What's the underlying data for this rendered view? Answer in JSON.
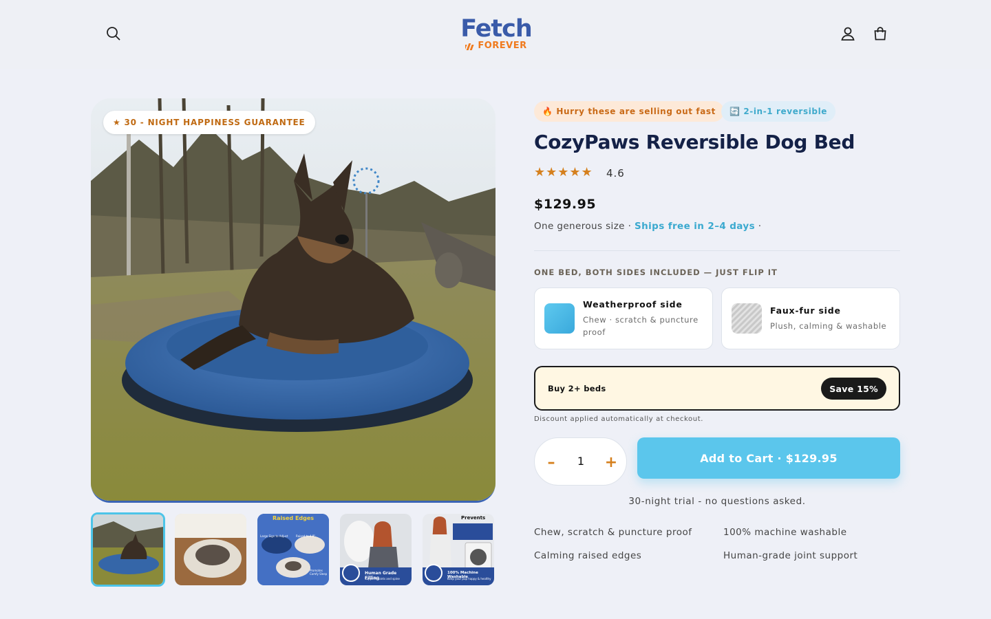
{
  "header": {
    "logo_top": "Fetch",
    "logo_bottom": "FOREVER",
    "search_icon": "search-icon",
    "account_icon": "user-icon",
    "cart_icon": "cart-icon"
  },
  "gallery": {
    "guarantee_badge": "★ 30 - NIGHT HAPPINESS GUARANTEE",
    "main_image": "German shepherd lying in a blue round dog bed outdoors",
    "thumbnails": [
      {
        "label": ""
      },
      {
        "label": ""
      },
      {
        "label": "Raised Edges"
      },
      {
        "label": "Human Grade Filling"
      },
      {
        "label": "100% Machine Washable"
      }
    ],
    "thumb_caption_prevents": "Prevents",
    "thumb_sub_1": "Large Sign to Adjust",
    "thumb_sub_2": "Raised to 4.8\"",
    "thumb_sub_3": "Promotes Comfy Sleep",
    "thumb_sub_4": "Supports joints and spine",
    "thumb_sub_5": "Keep your pup happy & healthy"
  },
  "product": {
    "badge_hurry": "🔥 Hurry these are selling out fast",
    "badge_reversible": "🔄 2-in-1 reversible",
    "title": "CozyPaws Reversible Dog Bed",
    "stars": "★★★★★",
    "rating": "4.6",
    "price": "$129.95",
    "size_text": "One generous size · ",
    "ships_text": "Ships free in 2–4 days",
    "ships_suffix": " ·",
    "sides_label": "ONE BED, BOTH SIDES INCLUDED — JUST FLIP IT",
    "sides": [
      {
        "title": "Weatherproof side",
        "desc_1": "Chew · scratch & puncture",
        "desc_2": "proof"
      },
      {
        "title": "Faux-fur side",
        "desc_1": "Plush, calming & washable"
      }
    ],
    "bundle_label": "Buy 2+ beds",
    "bundle_save": "Save 15%",
    "discount_note": "Discount applied automatically at checkout.",
    "quantity": "1",
    "qty_minus": "–",
    "qty_plus": "+",
    "add_to_cart": "Add to Cart · $129.95",
    "trial": "30-night trial - no questions asked.",
    "features": [
      "Chew, scratch & puncture proof",
      "100% machine washable",
      "Calming raised edges",
      "Human-grade joint support"
    ]
  },
  "colors": {
    "accent_blue": "#5bc6ec",
    "brand_blue": "#3a5ba9",
    "brand_orange": "#f07a1d",
    "star_orange": "#d5801e"
  }
}
